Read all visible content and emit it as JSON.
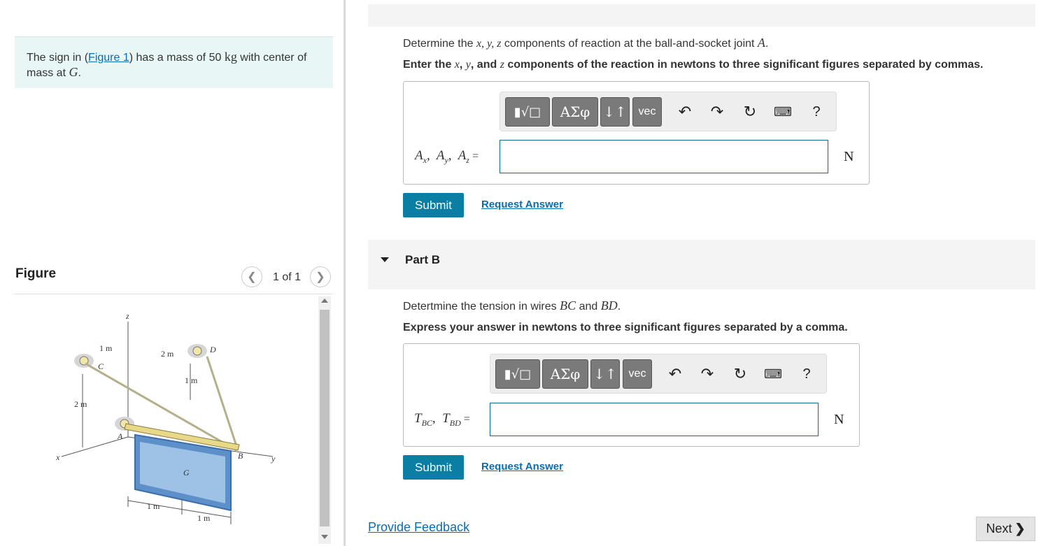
{
  "problem": {
    "text_before": "The sign in (",
    "figure_link": "Figure 1",
    "text_mid": ") has a mass of 50 ",
    "unit": "kg",
    "text_after": " with center of mass at ",
    "point": "G",
    "period": "."
  },
  "figure": {
    "title": "Figure",
    "pager": "1 of 1",
    "labels": {
      "z": "z",
      "x": "x",
      "y": "y",
      "C": "C",
      "D": "D",
      "A": "A",
      "B": "B",
      "G": "G",
      "d1m_top": "1 m",
      "d2m_top": "2 m",
      "d1m_mid": "1 m",
      "d2m_left": "2 m",
      "d1m_bot1": "1 m",
      "d1m_bot2": "1 m"
    }
  },
  "partA": {
    "prompt_pre": "Determine the ",
    "prompt_vars": "x, y, z",
    "prompt_post": " components of reaction at the ball-and-socket joint ",
    "prompt_point": "A",
    "prompt_end": ".",
    "instr_pre": "Enter the ",
    "instr_x": "x",
    "instr_y": "y",
    "instr_and": ", and ",
    "instr_z": "z",
    "instr_post": " components of the reaction in newtons to three significant figures separated by commas.",
    "label": "A",
    "label_full": "Ax, Ay, Az =",
    "unit": "N",
    "submit": "Submit",
    "request": "Request Answer"
  },
  "partB": {
    "header": "Part B",
    "prompt_pre": "Detertmine the tension in wires ",
    "w1": "BC",
    "and": " and ",
    "w2": "BD",
    "end": ".",
    "instr": "Express your answer in newtons to three significant figures separated by a comma.",
    "unit": "N",
    "submit": "Submit",
    "request": "Request Answer"
  },
  "toolbar": {
    "greek": "ΑΣφ",
    "arrows": "↓↑",
    "vec": "vec",
    "help": "?"
  },
  "footer": {
    "feedback": "Provide Feedback",
    "next": "Next"
  }
}
